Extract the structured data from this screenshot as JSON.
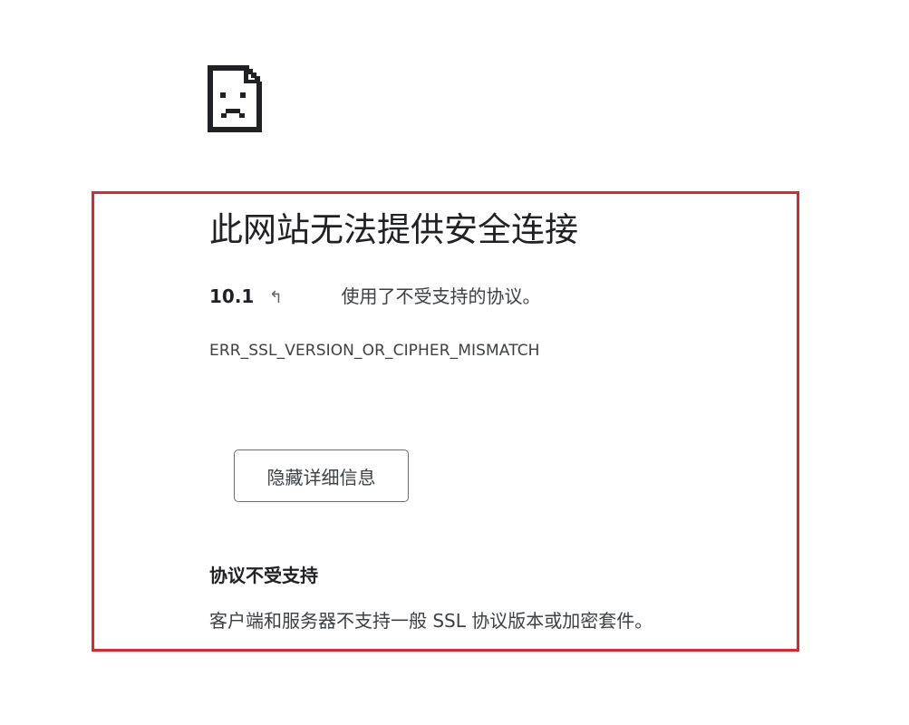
{
  "error_page": {
    "icon": "sad-page-icon",
    "heading": "此网站无法提供安全连接",
    "site": {
      "host": "10.1",
      "host_glyph": "↰",
      "message": "使用了不受支持的协议。"
    },
    "error_code": "ERR_SSL_VERSION_OR_CIPHER_MISMATCH",
    "details_button_label": "隐藏详细信息",
    "details": {
      "heading": "协议不受支持",
      "text": "客户端和服务器不支持一般 SSL 协议版本或加密套件。"
    }
  },
  "colors": {
    "highlight_border": "#e0262b",
    "text_primary": "#202124",
    "text_secondary": "#3c4043"
  }
}
